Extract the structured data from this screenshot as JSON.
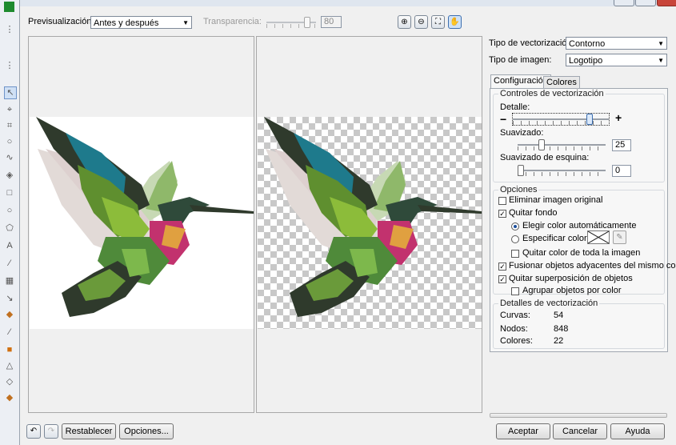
{
  "preview": {
    "label": "Previsualización:",
    "mode": "Antes y después",
    "transparency_label": "Transparencia:",
    "transparency_value": "80"
  },
  "toolbar_icons": [
    "zoom-in-icon",
    "zoom-out-icon",
    "fit-icon",
    "pan-hand-icon"
  ],
  "vectorization": {
    "type_label": "Tipo de vectorización:",
    "type_value": "Contorno",
    "image_label": "Tipo de imagen:",
    "image_value": "Logotipo"
  },
  "tabs": [
    "Configuración",
    "Colores"
  ],
  "controls": {
    "title": "Controles de vectorización",
    "detail_label": "Detalle:",
    "smoothing_label": "Suavizado:",
    "smoothing_value": "25",
    "corner_label": "Suavizado de esquina:",
    "corner_value": "0"
  },
  "options": {
    "title": "Opciones",
    "delete_original": "Eliminar imagen original",
    "remove_background": "Quitar fondo",
    "auto_color": "Elegir color automáticamente",
    "specify_color": "Especificar color:",
    "remove_color_all": "Quitar color de toda la imagen",
    "merge_adjacent": "Fusionar objetos adyacentes del mismo color",
    "remove_overlap": "Quitar superposición de objetos",
    "group_by_color": "Agrupar objetos por color"
  },
  "details": {
    "title": "Detalles de vectorización",
    "rows": [
      {
        "label": "Curvas:",
        "value": "54"
      },
      {
        "label": "Nodos:",
        "value": "848"
      },
      {
        "label": "Colores:",
        "value": "22"
      }
    ]
  },
  "buttons": {
    "reset": "Restablecer",
    "options": "Opciones...",
    "accept": "Aceptar",
    "cancel": "Cancelar",
    "help": "Ayuda"
  },
  "colors": {
    "accent": "#1a4e9c",
    "bird_dark": "#2f3a2c",
    "bird_green": "#5f8f2f",
    "bird_teal": "#1e7a8c",
    "bird_magenta": "#c2326e"
  }
}
